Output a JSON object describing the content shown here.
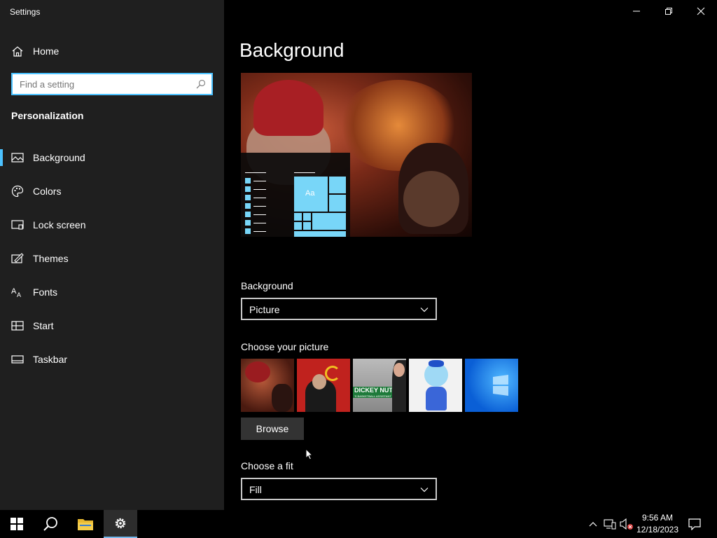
{
  "window": {
    "title": "Settings",
    "minimize_icon": "minimize-icon",
    "maximize_icon": "restore-icon",
    "close_icon": "close-icon"
  },
  "sidebar": {
    "home_label": "Home",
    "search_placeholder": "Find a setting",
    "section_title": "Personalization",
    "items": [
      {
        "label": "Background",
        "icon": "picture-icon",
        "active": true
      },
      {
        "label": "Colors",
        "icon": "palette-icon",
        "active": false
      },
      {
        "label": "Lock screen",
        "icon": "lock-screen-icon",
        "active": false
      },
      {
        "label": "Themes",
        "icon": "themes-icon",
        "active": false
      },
      {
        "label": "Fonts",
        "icon": "fonts-icon",
        "active": false
      },
      {
        "label": "Start",
        "icon": "start-icon",
        "active": false
      },
      {
        "label": "Taskbar",
        "icon": "taskbar-icon",
        "active": false
      }
    ]
  },
  "main": {
    "title": "Background",
    "preview_tile_text": "Aa",
    "background_label": "Background",
    "background_value": "Picture",
    "choose_picture_label": "Choose your picture",
    "thumbnail_texts": [
      "DICKEY NUTT",
      "'S BASKETBALL ASSISTANT"
    ],
    "browse_label": "Browse",
    "fit_label": "Choose a fit",
    "fit_value": "Fill"
  },
  "taskbar": {
    "time": "9:56 AM",
    "date": "12/18/2023",
    "accent": "#76b9ed"
  },
  "colors": {
    "sidebar_bg": "#1f1f1f",
    "accent": "#4cc2ff",
    "tile": "#78d6f8"
  }
}
